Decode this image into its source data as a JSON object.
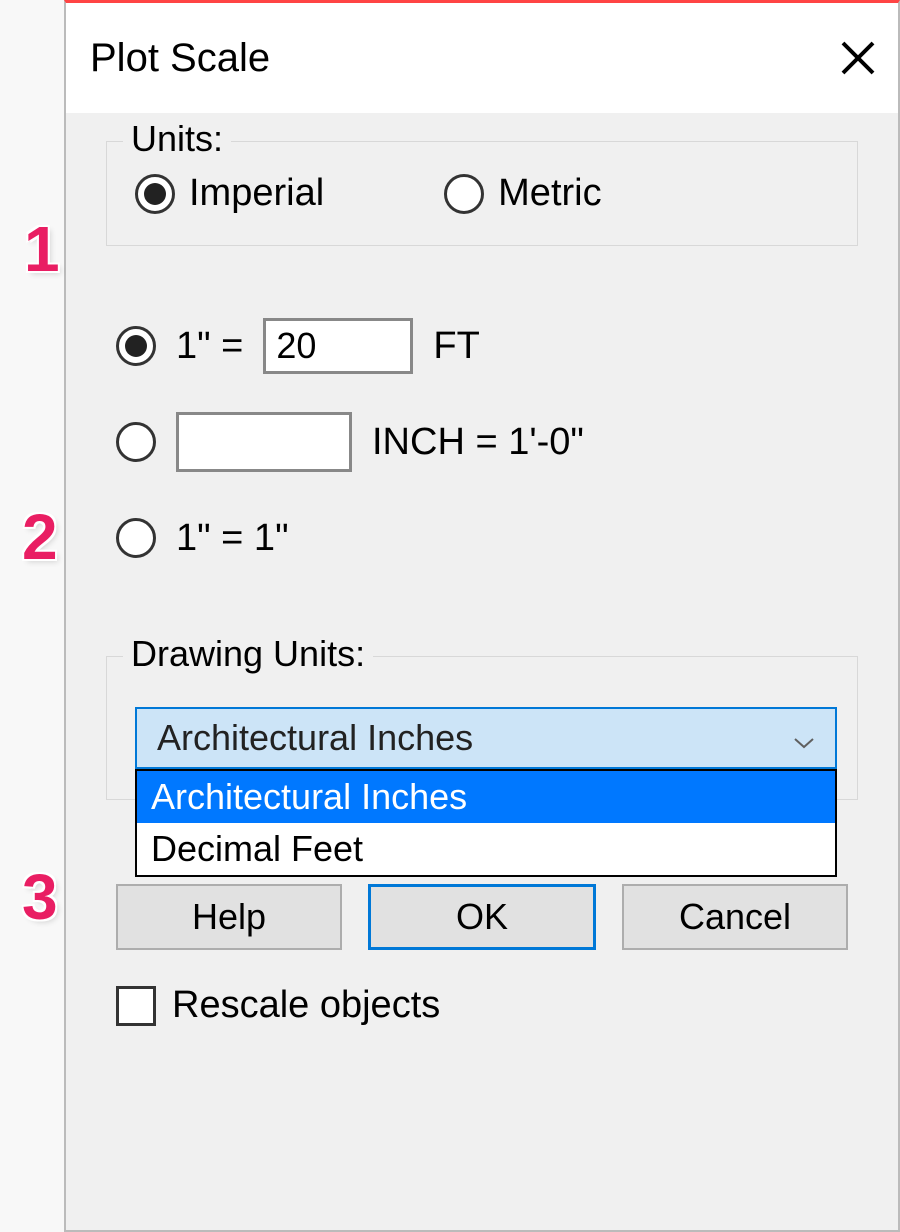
{
  "dialog": {
    "title": "Plot Scale",
    "units": {
      "legend": "Units:",
      "options": [
        "Imperial",
        "Metric"
      ],
      "selected": "Imperial"
    },
    "scale": {
      "row1_left": "1\" = ",
      "row1_value": "20",
      "row1_right": "FT",
      "row2_right": "INCH = 1'-0\"",
      "row3_text": "1\" = 1\"",
      "selected_index": 0
    },
    "drawing_units": {
      "legend": "Drawing Units:",
      "selected": "Architectural Inches",
      "options": [
        "Architectural Inches",
        "Decimal Feet"
      ]
    },
    "buttons": {
      "help": "Help",
      "ok": "OK",
      "cancel": "Cancel"
    },
    "rescale_label": "Rescale objects"
  },
  "annotations": [
    "1",
    "2",
    "3"
  ]
}
